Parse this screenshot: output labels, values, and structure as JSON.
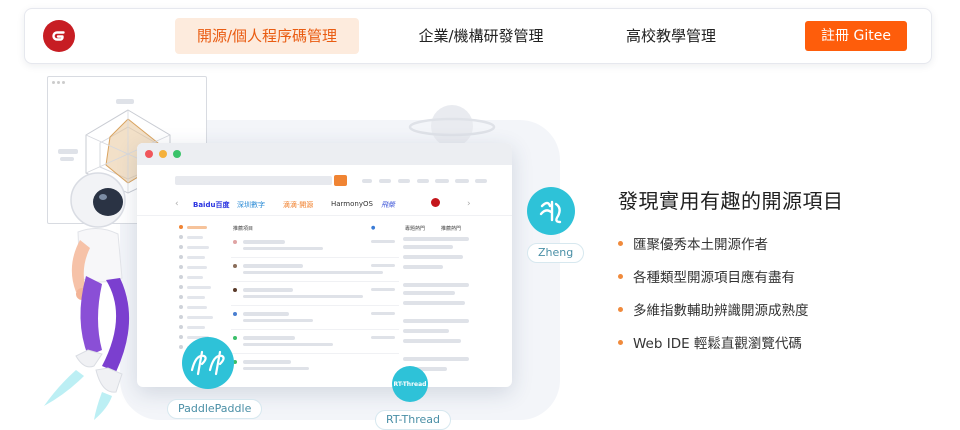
{
  "nav": {
    "tabs": [
      {
        "label": "開源/個人程序碼管理",
        "active": true
      },
      {
        "label": "企業/機構研發管理",
        "active": false
      },
      {
        "label": "高校教學管理",
        "active": false
      }
    ],
    "register_label": "註冊 Gitee",
    "logo_letter": "G"
  },
  "illustration": {
    "browser": {
      "brands": [
        "Baidu百度",
        "深圳數字",
        "滴滴·開源",
        "HarmonyOS",
        "飛槳",
        "華為"
      ],
      "list_header": "推薦項目",
      "right_tabs": [
        "專題熱門",
        "推薦熱門"
      ]
    },
    "badges": {
      "paddlepaddle": "PaddlePaddle",
      "zheng": "Zheng",
      "rt_thread": "RT-Thread"
    }
  },
  "features": {
    "headline": "發現實用有趣的開源項目",
    "items": [
      "匯聚優秀本土開源作者",
      "各種類型開源項目應有盡有",
      "多維指數輔助辨識開源成熟度",
      "Web IDE 輕鬆直觀瀏覽代碼"
    ]
  },
  "colors": {
    "brand_red": "#c71d23",
    "accent_orange": "#fe5d0b",
    "active_tab_bg": "#fdebdd",
    "badge_teal": "#2ec2d8",
    "bullet": "#f08a3c"
  }
}
